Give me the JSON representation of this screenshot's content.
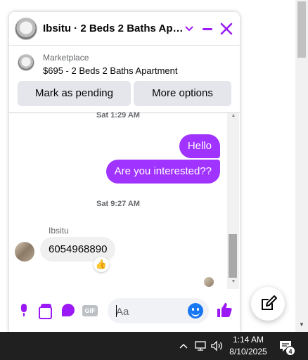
{
  "chat": {
    "title": "Ibsitu · 2 Beds 2 Baths Apa...",
    "marketplace": {
      "label": "Marketplace",
      "listing": "$695 - 2 Beds 2 Baths Apartment",
      "pending_button": "Mark as pending",
      "more_button": "More options"
    },
    "messages": {
      "timestamp_1": "Sat 1:29 AM",
      "outgoing_1": "Hello",
      "outgoing_2": "Are you interested??",
      "timestamp_2": "Sat 9:27 AM",
      "sender_name": "Ibsitu",
      "incoming_1": "6054968890",
      "reaction": "👍"
    },
    "composer": {
      "placeholder": "Aa",
      "gif_label": "GIF"
    },
    "accent_color": "#9b19f5",
    "bubble_color": "#a033ff"
  },
  "taskbar": {
    "time": "1:14 AM",
    "date": "8/10/2025",
    "notification_count": "4"
  }
}
